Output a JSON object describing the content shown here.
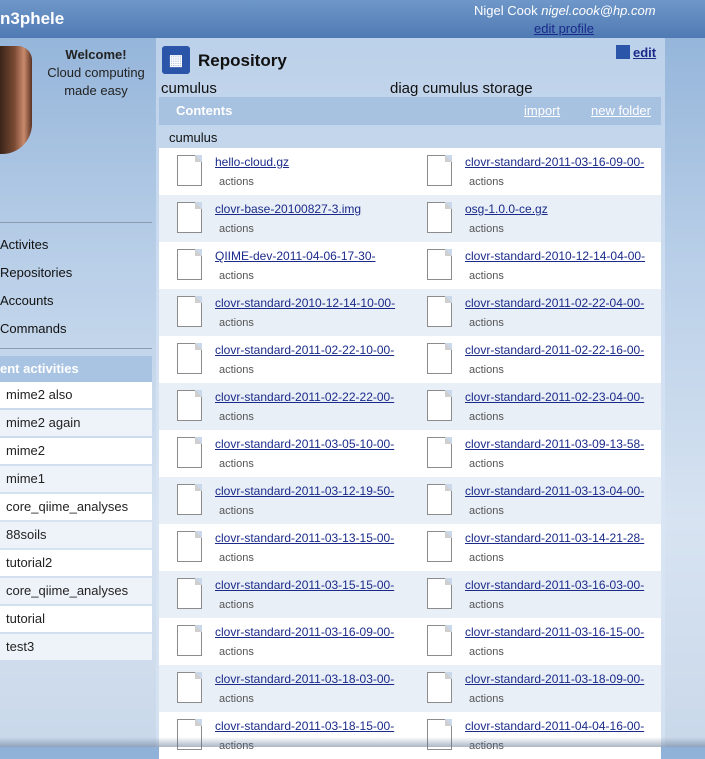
{
  "header": {
    "brand": "n3phele",
    "user_name": "Nigel Cook",
    "user_email": "nigel.cook@hp.com",
    "edit_profile": "edit profile"
  },
  "sidebar": {
    "welcome_title": "Welcome!",
    "tagline_1": "Cloud computing",
    "tagline_2": "made easy",
    "nav": [
      "Activites",
      "Repositories",
      "Accounts",
      "Commands"
    ],
    "recent_header": "ent activities",
    "recent": [
      "mime2 also",
      "mime2 again",
      "mime2",
      "mime1",
      "core_qiime_analyses",
      "88soils",
      "tutorial2",
      "core_qiime_analyses",
      "tutorial",
      "test3"
    ]
  },
  "main": {
    "title": "Repository",
    "edit": "edit",
    "repo_name": "cumulus",
    "repo_desc": "diag cumulus storage",
    "contents": "Contents",
    "import": "import",
    "new_folder": "new folder",
    "folder": "cumulus",
    "actions_label": "actions",
    "files": [
      [
        "hello-cloud.gz",
        "clovr-standard-2011-03-16-09-00-"
      ],
      [
        "clovr-base-20100827-3.img",
        "osg-1.0.0-ce.gz"
      ],
      [
        "QIIME-dev-2011-04-06-17-30-",
        "clovr-standard-2010-12-14-04-00-"
      ],
      [
        "clovr-standard-2010-12-14-10-00-",
        "clovr-standard-2011-02-22-04-00-"
      ],
      [
        "clovr-standard-2011-02-22-10-00-",
        "clovr-standard-2011-02-22-16-00-"
      ],
      [
        "clovr-standard-2011-02-22-22-00-",
        "clovr-standard-2011-02-23-04-00-"
      ],
      [
        "clovr-standard-2011-03-05-10-00-",
        "clovr-standard-2011-03-09-13-58-"
      ],
      [
        "clovr-standard-2011-03-12-19-50-",
        "clovr-standard-2011-03-13-04-00-"
      ],
      [
        "clovr-standard-2011-03-13-15-00-",
        "clovr-standard-2011-03-14-21-28-"
      ],
      [
        "clovr-standard-2011-03-15-15-00-",
        "clovr-standard-2011-03-16-03-00-"
      ],
      [
        "clovr-standard-2011-03-16-09-00-",
        "clovr-standard-2011-03-16-15-00-"
      ],
      [
        "clovr-standard-2011-03-18-03-00-",
        "clovr-standard-2011-03-18-09-00-"
      ],
      [
        "clovr-standard-2011-03-18-15-00-",
        "clovr-standard-2011-04-04-16-00-"
      ]
    ]
  }
}
